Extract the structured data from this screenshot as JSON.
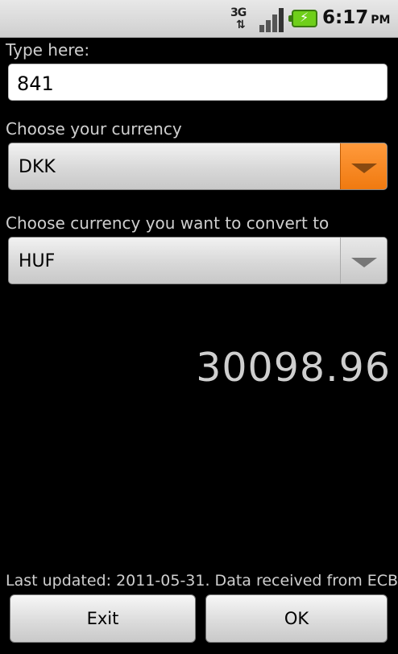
{
  "status_bar": {
    "network_label": "3G",
    "network_arrows": "⇅",
    "time": "6:17",
    "ampm": "PM"
  },
  "input": {
    "label": "Type here:",
    "value": "841"
  },
  "from_currency": {
    "label": "Choose your currency",
    "value": "DKK"
  },
  "to_currency": {
    "label": "Choose currency you want to convert to",
    "value": "HUF"
  },
  "result": "30098.96",
  "footer": "Last updated: 2011-05-31. Data received from ECB.",
  "buttons": {
    "exit": "Exit",
    "ok": "OK"
  }
}
